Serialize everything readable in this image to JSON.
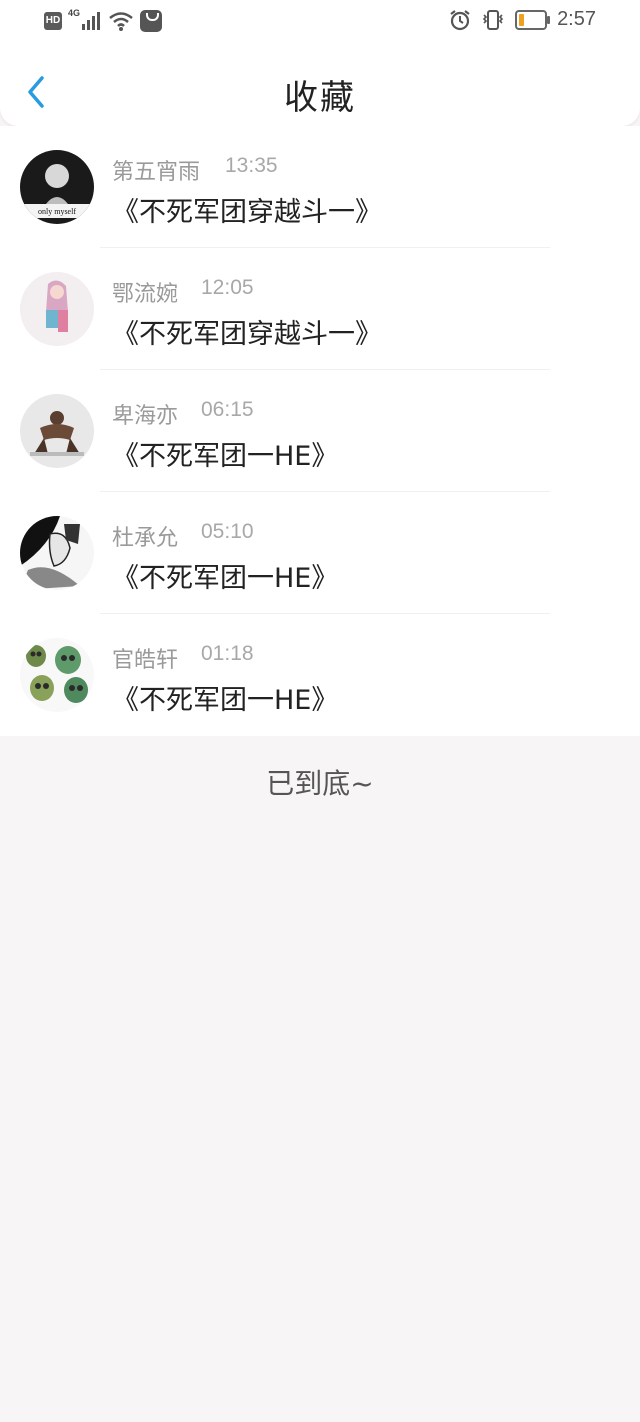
{
  "status_bar": {
    "hd_badge": "HD",
    "network": "4G",
    "time": "2:57",
    "battery_level": 0.2,
    "battery_color": "#f0a020"
  },
  "header": {
    "back_icon": "chevron-left-icon",
    "back_color": "#2a9be0",
    "title": "收藏"
  },
  "favorites": [
    {
      "name": "第五宵雨",
      "time": "13:35",
      "book": "《不死军团穿越斗一》",
      "avatar_text": "only myself"
    },
    {
      "name": "鄂流婉",
      "time": "12:05",
      "book": "《不死军团穿越斗一》"
    },
    {
      "name": "卑海亦",
      "time": "06:15",
      "book": "《不死军团一HE》"
    },
    {
      "name": "杜承允",
      "time": "05:10",
      "book": "《不死军团一HE》"
    },
    {
      "name": "官皓轩",
      "time": "01:18",
      "book": "《不死军团一HE》"
    }
  ],
  "footer": {
    "end_text": "已到底~"
  }
}
